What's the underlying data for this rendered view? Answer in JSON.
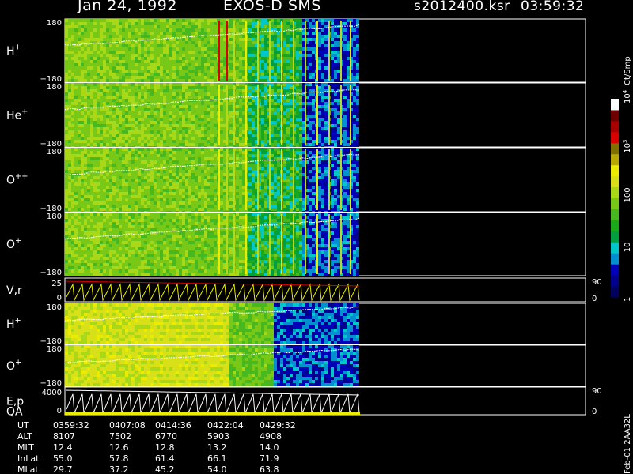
{
  "header": {
    "date": "Jan 24, 1992",
    "mission": "EXOS-D SMS",
    "file": "s2012400.ksr",
    "time": "03:59:32"
  },
  "colors": {
    "background": "#000000",
    "scale": [
      "#000060",
      "#00008c",
      "#0000b8",
      "#0090d0",
      "#00c8c8",
      "#00a040",
      "#1aa81a",
      "#48b820",
      "#78c818",
      "#a8d818",
      "#d8e018",
      "#ecec00",
      "#b8a800",
      "#807000",
      "#d80000",
      "#a80000",
      "#6e0000",
      "#ffffff"
    ]
  },
  "colorbar": {
    "label": "Ct/Smp",
    "ticks": [
      {
        "text": "10",
        "sup": "4",
        "level": 1.0
      },
      {
        "text": "10",
        "sup": "3",
        "level": 0.75
      },
      {
        "text": "100",
        "sup": "",
        "level": 0.5
      },
      {
        "text": "10",
        "sup": "",
        "level": 0.25
      },
      {
        "text": "1",
        "sup": "",
        "level": 0.0
      }
    ]
  },
  "chart_data": {
    "type": "heatmap",
    "panels": [
      {
        "name": "H",
        "sup": "+",
        "ymin": -180,
        "ymax": 180,
        "ytick_top": "180",
        "ytick_bottom": "−180",
        "kind": "pitch"
      },
      {
        "name": "He",
        "sup": "+",
        "ymin": -180,
        "ymax": 180,
        "ytick_top": "180",
        "ytick_bottom": "−180",
        "kind": "pitch"
      },
      {
        "name": "O",
        "sup": "++",
        "ymin": -180,
        "ymax": 180,
        "ytick_top": "180",
        "ytick_bottom": "−180",
        "kind": "pitch"
      },
      {
        "name": "O",
        "sup": "+",
        "ymin": -180,
        "ymax": 180,
        "ytick_top": "180",
        "ytick_bottom": "−180",
        "kind": "pitch"
      },
      {
        "name": "V,r",
        "sup": "",
        "kind": "lines",
        "left_ticks": [
          "25",
          "0"
        ],
        "right_ticks": [
          "90",
          "0"
        ]
      },
      {
        "name": "H",
        "sup": "+",
        "ymin": -180,
        "ymax": 180,
        "ytick_top": "180",
        "ytick_bottom": "−180",
        "kind": "pitch2"
      },
      {
        "name": "O",
        "sup": "+",
        "ymin": -180,
        "ymax": 180,
        "ytick_top": "180",
        "ytick_bottom": "−180",
        "kind": "pitch2"
      },
      {
        "name": "E,p",
        "sup": "",
        "name2": "QA",
        "kind": "lines",
        "left_ticks": [
          "4000",
          "0"
        ],
        "right_ticks": [
          "90",
          "0"
        ]
      }
    ],
    "ephemeris": {
      "labels": [
        "UT",
        "ALT",
        "MLT",
        "InLat",
        "MLat"
      ],
      "columns": [
        [
          "0359:32",
          "8107",
          "12.4",
          "55.0",
          "29.7"
        ],
        [
          "0407:08",
          "7502",
          "12.6",
          "57.8",
          "37.2"
        ],
        [
          "0414:36",
          "6770",
          "12.8",
          "61.4",
          "45.2"
        ],
        [
          "0422:04",
          "5903",
          "13.2",
          "66.1",
          "54.0"
        ],
        [
          "0429:32",
          "4908",
          "14.0",
          "71.9",
          "63.8"
        ]
      ]
    },
    "side_label": "Feb-01 2AA32L"
  }
}
